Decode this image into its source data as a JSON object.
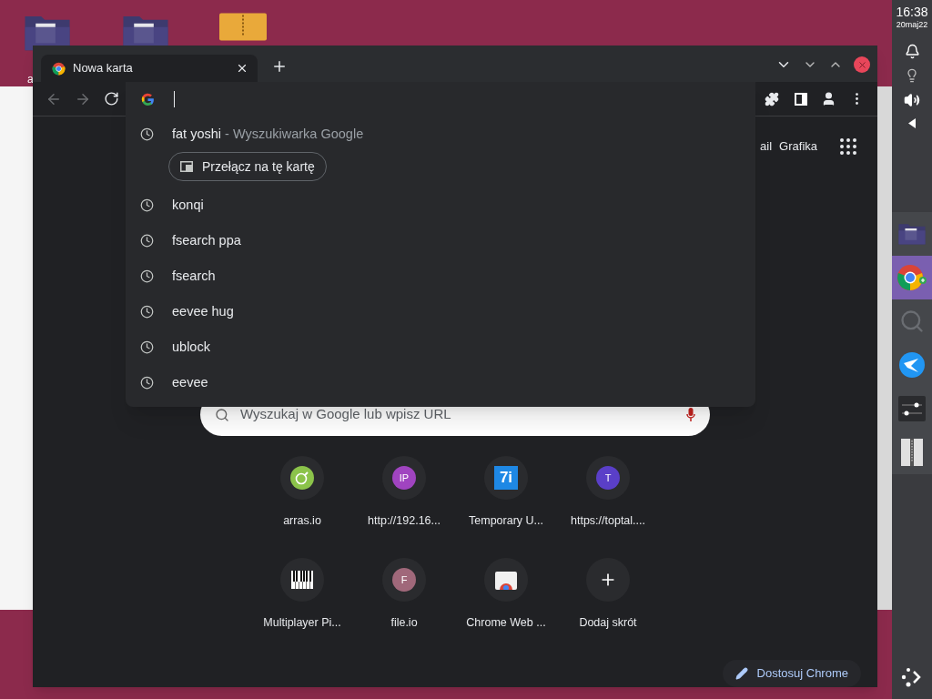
{
  "desktop": {
    "icons": [
      {
        "kind": "folder"
      },
      {
        "kind": "folder"
      },
      {
        "kind": "archive"
      }
    ],
    "label": "a"
  },
  "browser": {
    "tab": {
      "title": "Nowa karta"
    },
    "suggestions": [
      {
        "text": "fat yoshi",
        "suffix": "- Wyszukiwarka Google",
        "action": "Przełącz na tę kartę"
      },
      {
        "text": "konqi"
      },
      {
        "text": "fsearch ppa"
      },
      {
        "text": "fsearch"
      },
      {
        "text": "eevee hug"
      },
      {
        "text": "ublock"
      },
      {
        "text": "eevee"
      }
    ],
    "header_links": [
      "ail",
      "Grafika"
    ],
    "search": {
      "placeholder": "Wyszukaj w Google lub wpisz URL"
    },
    "shortcuts": [
      {
        "label": "arras.io",
        "kind": "ring",
        "color": "#8bc34a"
      },
      {
        "label": "http://192.16...",
        "kind": "letter",
        "icon_text": "IP",
        "color": "#a044c0"
      },
      {
        "label": "Temporary U...",
        "kind": "square",
        "icon_text": "7i",
        "color": "#1e88e5"
      },
      {
        "label": "https://toptal....",
        "kind": "letter",
        "icon_text": "T",
        "color": "#5a3fc8"
      },
      {
        "label": "Multiplayer Pi...",
        "kind": "piano"
      },
      {
        "label": "file.io",
        "kind": "letter",
        "icon_text": "F",
        "color": "#a0687a"
      },
      {
        "label": "Chrome Web ...",
        "kind": "store"
      },
      {
        "label": "Dodaj skrót",
        "kind": "add"
      }
    ],
    "customize": "Dostosuj Chrome"
  },
  "panel": {
    "time": "16:38",
    "date": "20maj22",
    "apps": [
      {
        "kind": "folder",
        "selected": false
      },
      {
        "kind": "chrome",
        "selected": true
      },
      {
        "kind": "search",
        "selected": false
      },
      {
        "kind": "globe",
        "selected": false
      },
      {
        "kind": "sliders",
        "selected": false
      },
      {
        "kind": "archive",
        "selected": false
      }
    ]
  }
}
